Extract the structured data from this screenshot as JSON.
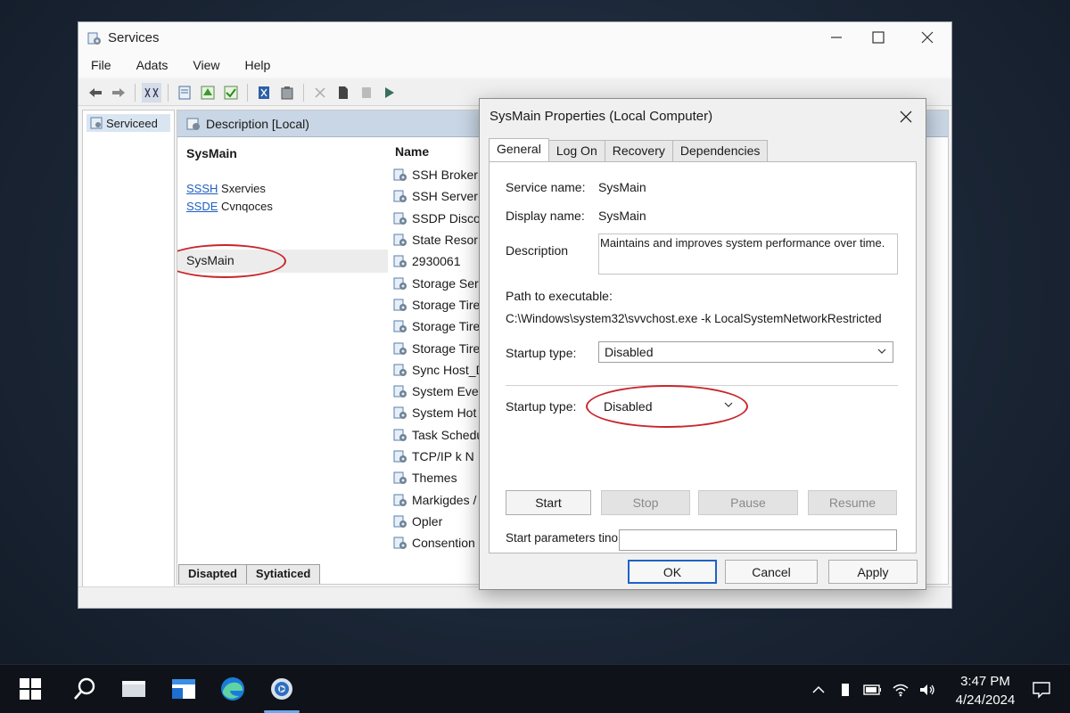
{
  "window": {
    "title": "Services",
    "menu": [
      "File",
      "Adats",
      "View",
      "Help"
    ]
  },
  "tree": {
    "item": "Serviceed"
  },
  "content": {
    "header": "Description [Local)",
    "selected_service_title": "SysMain",
    "links": [
      {
        "link": "SSSH",
        "text": " Sxervies"
      },
      {
        "link": "SSDE",
        "text": " Cvnqoces"
      }
    ],
    "selected_row_label": "SysMain",
    "name_header": "Name",
    "services": [
      "SSH Broker",
      "SSH Server c",
      "SSDP Disco",
      "State Resor",
      "2930061",
      "Storage Serv",
      "Storage Tire",
      "Storage Tire",
      "Storage Tire",
      "Sync Host_D",
      "System Ever",
      "System Hot",
      "Task Schedu",
      "TCP/IP k N",
      "Themes",
      "Markigdes /",
      "Opler",
      "Consention"
    ],
    "bottom_tabs": [
      "Disapted",
      "Sytiaticed"
    ]
  },
  "dialog": {
    "title": "SysMain Properties (Local Computer)",
    "tabs": [
      "General",
      "Log On",
      "Recovery",
      "Dependencies"
    ],
    "active_tab": "General",
    "service_name_label": "Service name:",
    "service_name": "SysMain",
    "display_name_label": "Display name:",
    "display_name": "SysMain",
    "description_label": "Description",
    "description": "Maintains and improves system performance over time.",
    "path_label": "Path to executable:",
    "path": "C:\\Windows\\system32\\svvchost.exe -k LocalSystemNetworkRestricted",
    "startup_label_1": "Startup type:",
    "startup_value_1": "Disabled",
    "startup_label_2": "Startup type:",
    "startup_value_2": "Disabled",
    "buttons": {
      "start": "Start",
      "stop": "Stop",
      "pause": "Pause",
      "resume": "Resume"
    },
    "params_label": "Start parameters tino:",
    "ok": "OK",
    "cancel": "Cancel",
    "apply": "Apply"
  },
  "taskbar": {
    "time": "3:47 PM",
    "date": "4/24/2024"
  },
  "colors": {
    "highlight_ellipse": "#c8262b",
    "link": "#1f5fbf",
    "default_button_border": "#1e63c4",
    "desktop": "#1b2636"
  },
  "icons": [
    "services-app-icon",
    "minimize-icon",
    "maximize-icon",
    "close-icon",
    "back-icon",
    "forward-icon",
    "start-icon",
    "search-icon",
    "edge-icon",
    "settings-icon",
    "wifi-icon",
    "volume-icon",
    "battery-icon",
    "notification-icon"
  ]
}
